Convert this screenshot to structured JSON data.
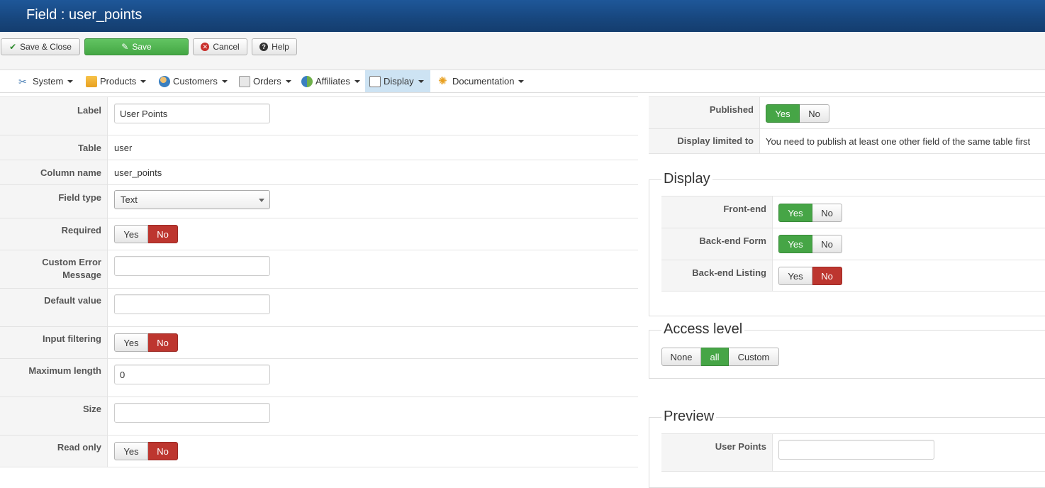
{
  "header": {
    "title": "Field : user_points"
  },
  "toolbar": {
    "save_close": "Save & Close",
    "save": "Save",
    "cancel": "Cancel",
    "help": "Help"
  },
  "menu": {
    "items": [
      "System",
      "Products",
      "Customers",
      "Orders",
      "Affiliates",
      "Display",
      "Documentation"
    ],
    "active": "Display"
  },
  "form": {
    "label": {
      "label": "Label",
      "value": "User Points"
    },
    "table": {
      "label": "Table",
      "value": "user"
    },
    "column": {
      "label": "Column name",
      "value": "user_points"
    },
    "field_type": {
      "label": "Field type",
      "value": "Text"
    },
    "required": {
      "label": "Required",
      "yes": "Yes",
      "no": "No",
      "selected": "No"
    },
    "custom_error": {
      "label_line1": "Custom Error",
      "label_line2": "Message",
      "value": ""
    },
    "default_value": {
      "label": "Default value",
      "value": ""
    },
    "input_filtering": {
      "label": "Input filtering",
      "yes": "Yes",
      "no": "No",
      "selected": "No"
    },
    "max_length": {
      "label": "Maximum length",
      "value": "0"
    },
    "size": {
      "label": "Size",
      "value": ""
    },
    "read_only": {
      "label": "Read only",
      "yes": "Yes",
      "no": "No",
      "selected": "No"
    }
  },
  "right": {
    "published": {
      "label": "Published",
      "yes": "Yes",
      "no": "No",
      "selected": "Yes"
    },
    "display_limited": {
      "label": "Display limited to",
      "value": "You need to publish at least one other field of the same table first"
    },
    "display": {
      "legend": "Display",
      "frontend": {
        "label": "Front-end",
        "yes": "Yes",
        "no": "No",
        "selected": "Yes"
      },
      "backend_form": {
        "label": "Back-end Form",
        "yes": "Yes",
        "no": "No",
        "selected": "Yes"
      },
      "backend_listing": {
        "label": "Back-end Listing",
        "yes": "Yes",
        "no": "No",
        "selected": "No"
      }
    },
    "access": {
      "legend": "Access level",
      "none": "None",
      "all": "all",
      "custom": "Custom",
      "selected": "all"
    },
    "preview": {
      "legend": "Preview",
      "field_label": "User Points",
      "value": ""
    }
  },
  "colors": {
    "green": "#46a546",
    "red": "#bd362f",
    "header": "#1e5799",
    "active_menu": "#cde3f3"
  }
}
